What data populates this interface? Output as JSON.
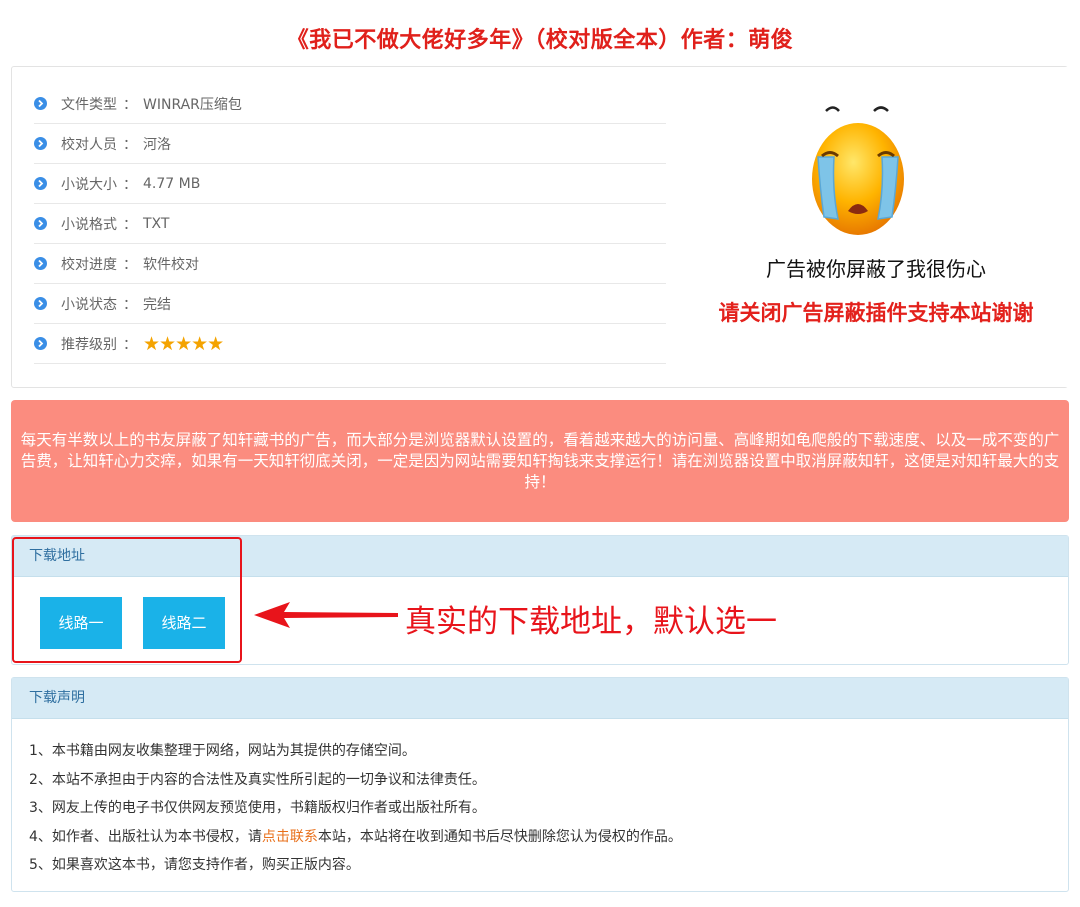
{
  "page_title": "《我已不做大佬好多年》（校对版全本）作者：萌俊",
  "info": {
    "rows": [
      {
        "label": "文件类型",
        "colon": "：",
        "value": "WINRAR压缩包"
      },
      {
        "label": "校对人员",
        "colon": "：",
        "value": "河洛"
      },
      {
        "label": "小说大小",
        "colon": "：",
        "value": "4.77 MB"
      },
      {
        "label": "小说格式",
        "colon": "：",
        "value": "TXT"
      },
      {
        "label": "校对进度",
        "colon": "：",
        "value": "软件校对"
      },
      {
        "label": "小说状态",
        "colon": "：",
        "value": "完结"
      },
      {
        "label": "推荐级别",
        "colon": "：",
        "value": "★★★★★"
      }
    ],
    "rating": 5
  },
  "ad": {
    "line1": "广告被你屏蔽了我很伤心",
    "line2": "请关闭广告屏蔽插件支持本站谢谢"
  },
  "notice": {
    "text": "每天有半数以上的书友屏蔽了知轩藏书的广告，而大部分是浏览器默认设置的，看着越来越大的访问量、高峰期如龟爬般的下载速度、以及一成不变的广告费，让知轩心力交瘁，如果有一天知轩彻底关闭，一定是因为网站需要知轩掏钱来支撑运行！请在浏览器设置中取消屏蔽知轩，这便是对知轩最大的支持！"
  },
  "download": {
    "heading": "下载地址",
    "btn1": "线路一",
    "btn2": "线路二",
    "annotation": "真实的下载地址，默认选一"
  },
  "declaration": {
    "heading": "下载声明",
    "item1": "1、本书籍由网友收集整理于网络，网站为其提供的存储空间。",
    "item2": "2、本站不承担由于内容的合法性及真实性所引起的一切争议和法律责任。",
    "item3": "3、网友上传的电子书仅供网友预览使用，书籍版权归作者或出版社所有。",
    "item4_pre": "4、如作者、出版社认为本书侵权，请",
    "item4_link": "点击联系",
    "item4_post": "本站，本站将在收到通知书后尽快删除您认为侵权的作品。",
    "item5": "5、如果喜欢这本书，请您支持作者，购买正版内容。"
  },
  "colors": {
    "title": "#e0201b",
    "notice_bg": "#fb8c7f",
    "button": "#1ab2e8",
    "annotation": "#e8141b",
    "link": "#e8701b"
  },
  "icons": [
    "chevron-circle-right-icon",
    "crying-face-icon",
    "red-arrow-left-icon"
  ]
}
